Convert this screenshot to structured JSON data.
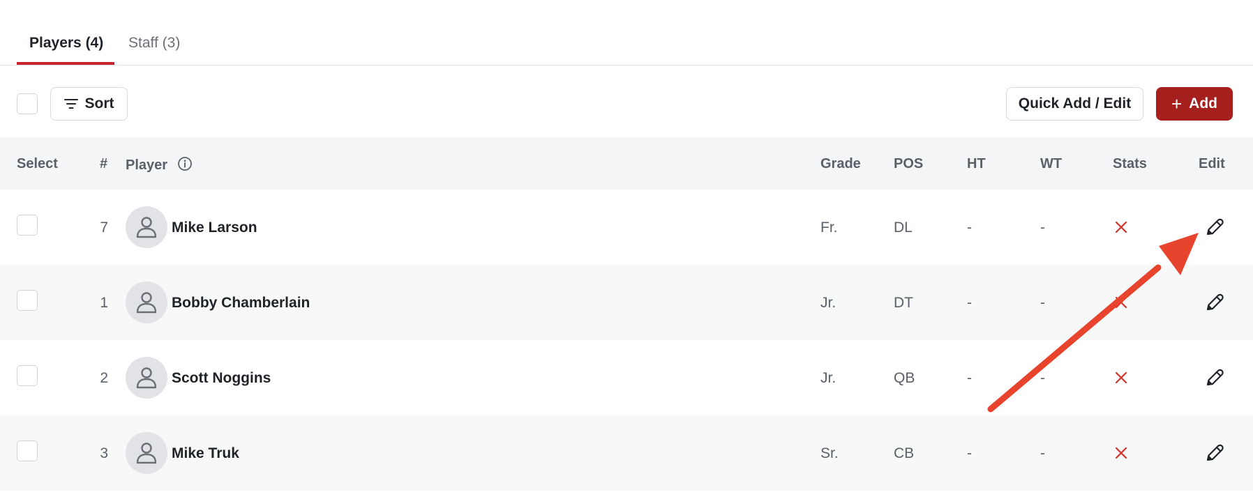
{
  "tabs": [
    {
      "label": "Players (4)",
      "active": true
    },
    {
      "label": "Staff (3)",
      "active": false
    }
  ],
  "toolbar": {
    "sort_label": "Sort",
    "quick_label": "Quick Add / Edit",
    "add_label": "Add"
  },
  "table": {
    "headers": {
      "select": "Select",
      "number": "#",
      "player": "Player",
      "grade": "Grade",
      "pos": "POS",
      "ht": "HT",
      "wt": "WT",
      "stats": "Stats",
      "edit": "Edit"
    },
    "rows": [
      {
        "number": "7",
        "name": "Mike Larson",
        "grade": "Fr.",
        "pos": "DL",
        "ht": "-",
        "wt": "-"
      },
      {
        "number": "1",
        "name": "Bobby Chamberlain",
        "grade": "Jr.",
        "pos": "DT",
        "ht": "-",
        "wt": "-"
      },
      {
        "number": "2",
        "name": "Scott Noggins",
        "grade": "Jr.",
        "pos": "QB",
        "ht": "-",
        "wt": "-"
      },
      {
        "number": "3",
        "name": "Mike Truk",
        "grade": "Sr.",
        "pos": "CB",
        "ht": "-",
        "wt": "-"
      }
    ]
  },
  "icons": {
    "sort": "filter-lines-icon",
    "add": "plus-icon",
    "info": "info-circle-icon",
    "avatar": "user-icon",
    "stats": "x-mark-icon",
    "edit": "pencil-icon",
    "annotation": "red-arrow"
  },
  "colors": {
    "accent": "#c8232b",
    "primary_button": "#a5201c",
    "stats_x": "#d0312d",
    "annotation_arrow": "#e8432d"
  }
}
